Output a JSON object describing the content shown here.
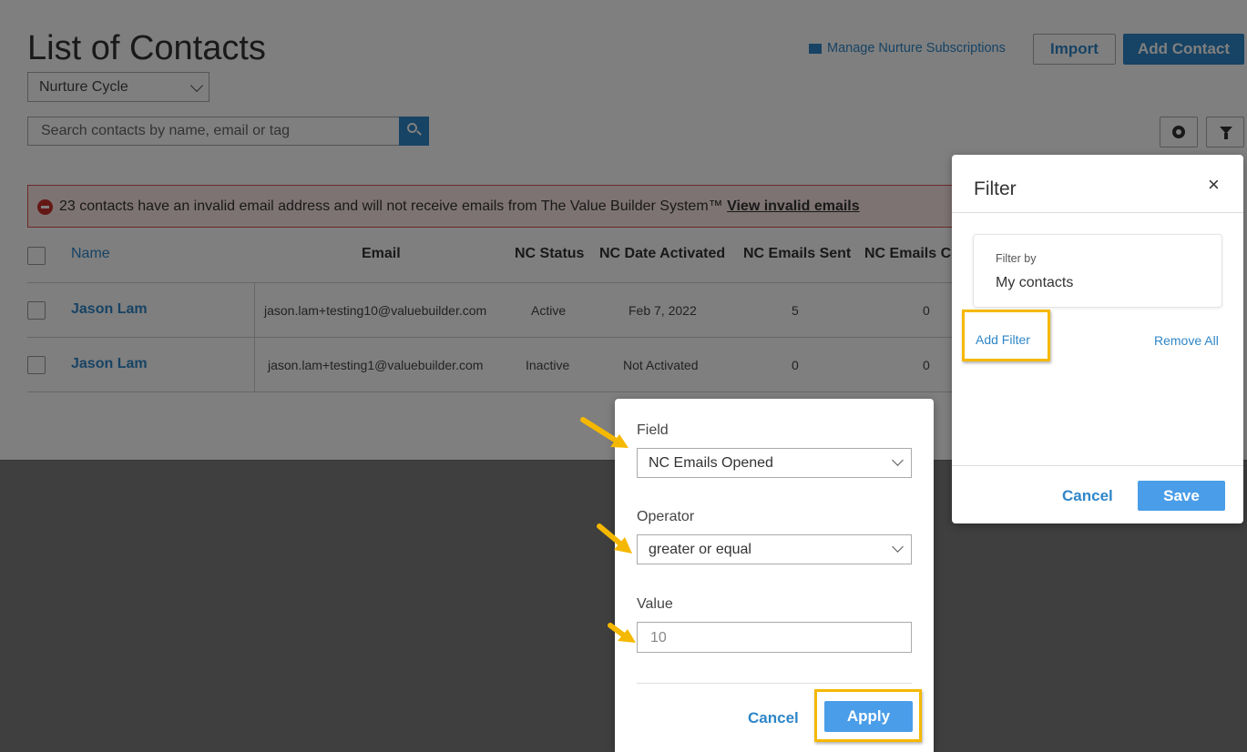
{
  "page": {
    "title": "List of Contacts",
    "view_select": "Nurture Cycle",
    "manage_link": "Manage Nurture Subscriptions",
    "import_label": "Import",
    "add_contact_label": "Add Contact",
    "search_placeholder": "Search contacts by name, email or tag",
    "alert_text": "23 contacts have an invalid email address and will not receive emails from The Value Builder System™ ",
    "alert_link": "View invalid emails"
  },
  "table": {
    "headers": [
      "Name",
      "Email",
      "NC Status",
      "NC Date Activated",
      "NC Emails Sent",
      "NC Emails Cl"
    ],
    "rows": [
      {
        "name": "Jason Lam",
        "email": "jason.lam+testing10@valuebuilder.com",
        "status": "Active",
        "date": "Feb 7, 2022",
        "sent": "5",
        "clicked": "0"
      },
      {
        "name": "Jason Lam",
        "email": "jason.lam+testing1@valuebuilder.com",
        "status": "Inactive",
        "date": "Not Activated",
        "sent": "0",
        "clicked": "0"
      }
    ]
  },
  "filter_panel": {
    "title": "Filter",
    "close": "×",
    "filter_by_label": "Filter by",
    "filter_by_value": "My contacts",
    "add_filter": "Add Filter",
    "remove_all": "Remove All",
    "cancel": "Cancel",
    "save": "Save"
  },
  "filter_dialog": {
    "field_label": "Field",
    "field_value": "NC Emails Opened",
    "operator_label": "Operator",
    "operator_value": "greater or equal",
    "value_label": "Value",
    "value_placeholder": "10",
    "cancel": "Cancel",
    "apply": "Apply"
  },
  "colors": {
    "accent": "#2f86c8",
    "highlight": "#f5b800",
    "alert_border": "#d9534f"
  }
}
